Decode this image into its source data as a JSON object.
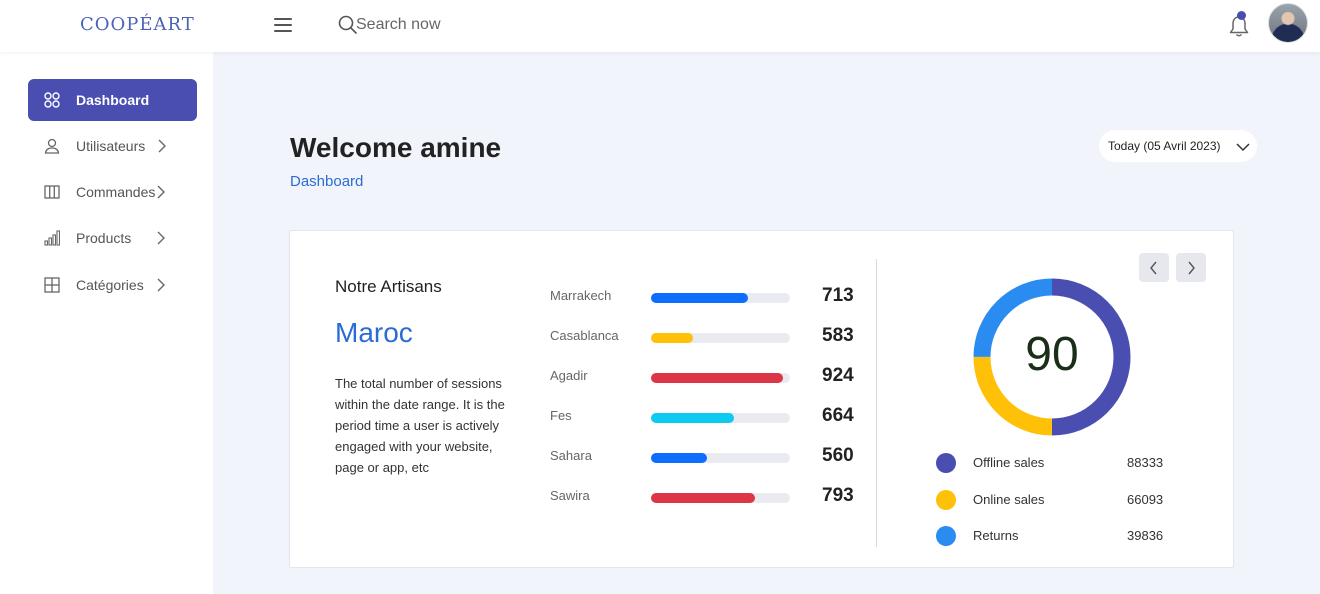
{
  "header": {
    "logo": "COOPÉART",
    "search_placeholder": "Search now"
  },
  "sidebar": {
    "items": [
      {
        "label": "Dashboard",
        "icon": "dashboard-icon",
        "active": true
      },
      {
        "label": "Utilisateurs",
        "icon": "user-icon"
      },
      {
        "label": "Commandes",
        "icon": "columns-icon"
      },
      {
        "label": "Products",
        "icon": "bar-chart-icon"
      },
      {
        "label": "Catégories",
        "icon": "grid-icon"
      }
    ]
  },
  "main": {
    "welcome": "Welcome amine",
    "breadcrumb": "Dashboard",
    "date_filter": "Today (05 Avril 2023)"
  },
  "card": {
    "title": "Notre Artisans",
    "country": "Maroc",
    "description": "The total number of sessions within the date range. It is the period time a user is actively engaged with your website, page or app, etc",
    "cities": [
      {
        "name": "Marrakech",
        "value": "713",
        "fill": 0.7,
        "color": "#0d6efd"
      },
      {
        "name": "Casablanca",
        "value": "583",
        "fill": 0.3,
        "color": "#ffc107"
      },
      {
        "name": "Agadir",
        "value": "924",
        "fill": 0.95,
        "color": "#dc3545"
      },
      {
        "name": "Fes",
        "value": "664",
        "fill": 0.6,
        "color": "#0dcaf0"
      },
      {
        "name": "Sahara",
        "value": "560",
        "fill": 0.4,
        "color": "#0d6efd"
      },
      {
        "name": "Sawira",
        "value": "793",
        "fill": 0.75,
        "color": "#dc3545"
      }
    ],
    "donut": {
      "center": "90",
      "segments": [
        {
          "fraction": 0.5,
          "color": "#4a4eb0"
        },
        {
          "fraction": 0.25,
          "color": "#ffc107"
        },
        {
          "fraction": 0.25,
          "color": "#2a8cf0"
        }
      ]
    },
    "legend": [
      {
        "label": "Offline sales",
        "value": "88333",
        "color": "#4a4eb0"
      },
      {
        "label": "Online sales",
        "value": "66093",
        "color": "#ffc107"
      },
      {
        "label": "Returns",
        "value": "39836",
        "color": "#2a8cf0"
      }
    ]
  }
}
